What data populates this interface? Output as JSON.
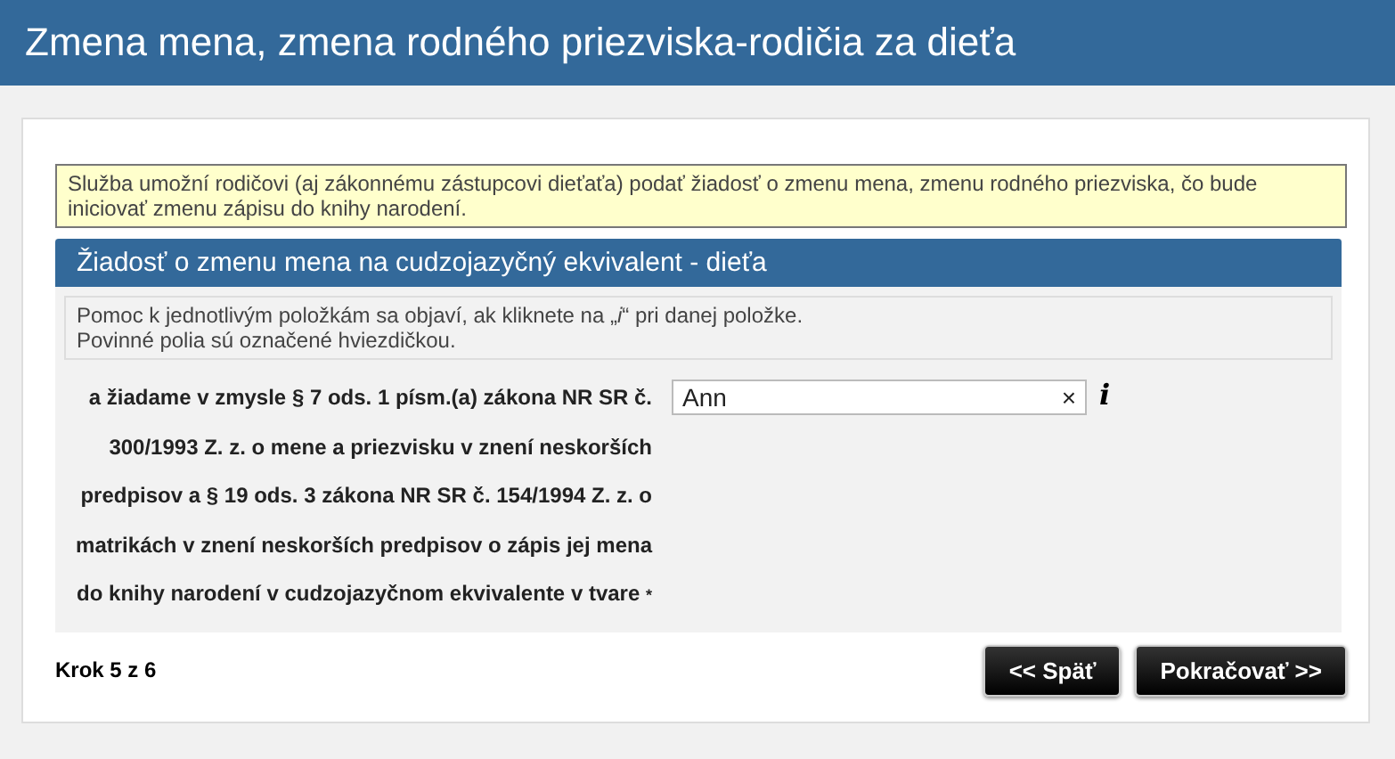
{
  "header": {
    "title": "Zmena mena, zmena rodného priezviska-rodičia za dieťa"
  },
  "notice": "Služba umožní rodičovi (aj zákonnému zástupcovi dieťaťa) podať žiadosť o zmenu mena, zmenu rodného priezviska, čo bude iniciovať zmenu zápisu do knihy narodení.",
  "section": {
    "title": "Žiadosť o zmenu mena na cudzojazyčný ekvivalent - dieťa",
    "help": [
      "Pomoc k jednotlivým položkám sa objaví, ak kliknete na „*i*“ pri danej položke.",
      "Povinné polia sú označené hviezdičkou."
    ],
    "fields": [
      {
        "label": "a žiadame v zmysle § 7 ods. 1 písm.(a) zákona NR SR č. 300/1993 Z. z. o mene a priezvisku v znení neskorších predpisov a § 19 ods. 3 zákona NR SR č. 154/1994 Z. z. o matrikách v znení neskorších predpisov o zápis jej mena do knihy narodení v cudzojazyčnom ekvivalente v tvare",
        "required_mark": "*",
        "value": "Ann",
        "clear": "×",
        "info": "i"
      }
    ]
  },
  "footer": {
    "step": "Krok 5 z 6",
    "buttons": [
      "<< Späť",
      "Pokračovať >>"
    ]
  }
}
